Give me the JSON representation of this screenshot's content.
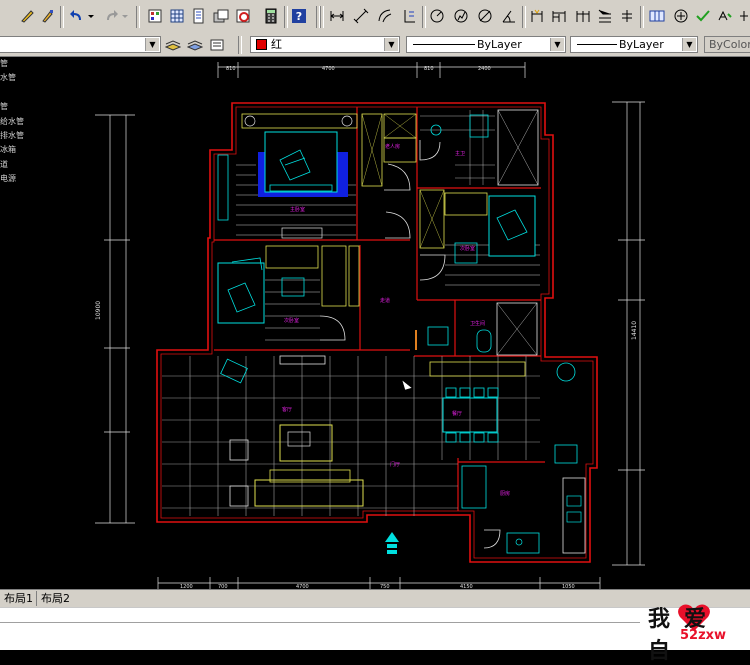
{
  "toolbar2": {
    "color_value": "红",
    "color_swatch": "#e00000",
    "linetype_value": "ByLayer",
    "lineweight_value": "ByLayer",
    "plotstyle_value": "ByColor"
  },
  "left_panel": {
    "items": [
      "管",
      "水管",
      "管",
      "给水管",
      "排水管",
      "冰箱",
      "道",
      "电源"
    ]
  },
  "drawing": {
    "top_dimensions": [
      "810",
      "4700",
      "810",
      "2400"
    ],
    "bottom_dimensions": [
      "1200",
      "700",
      "4700",
      "750",
      "4150",
      "1050"
    ],
    "left_dimension_total": "10900",
    "right_dimension_total": "14410",
    "rooms": [
      "主卧室",
      "主卫",
      "老人房",
      "次卧室",
      "客厅",
      "餐厅",
      "厨房",
      "卫生间",
      "走道",
      "门厅"
    ]
  },
  "layout_tabs": [
    "布局1",
    "布局2"
  ],
  "watermark": {
    "text": "我爱自",
    "url": "52zxw"
  },
  "icons": [
    "pencil-icon",
    "brush-icon",
    "undo-icon",
    "redo-icon",
    "properties-icon",
    "design-center-icon",
    "tool-palette-icon",
    "sheet-set-icon",
    "markup-icon",
    "calculator-icon",
    "help-icon",
    "dimension-linear-icon",
    "dimension-aligned-icon",
    "dimension-arc-icon",
    "dimension-ordinate-icon",
    "dimension-radius-icon",
    "dimension-jogged-icon",
    "dimension-diameter-icon",
    "dimension-angular-icon",
    "quick-dimension-icon",
    "baseline-icon",
    "continue-icon",
    "quick-leader-icon",
    "tolerance-icon",
    "center-mark-icon",
    "dimension-edit-icon",
    "dimension-text-edit-icon",
    "dimension-update-icon"
  ]
}
